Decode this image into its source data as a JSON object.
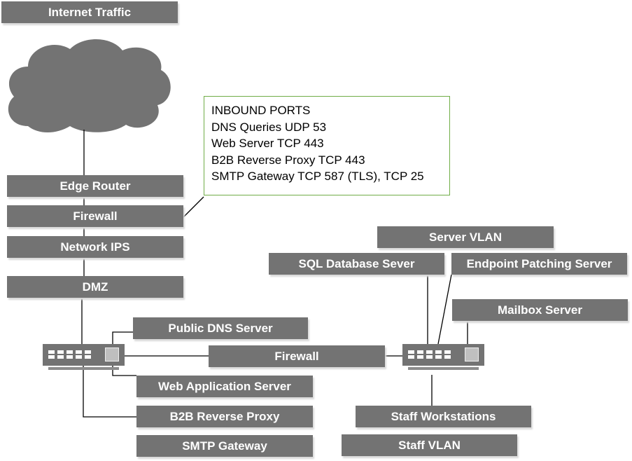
{
  "title": "Internet Traffic",
  "cloud_icon": "cloud-icon",
  "left_chain": [
    "Edge Router",
    "Firewall",
    "Network IPS",
    "DMZ"
  ],
  "callout": {
    "border_color": "#70ad47",
    "lines": [
      "INBOUND PORTS",
      "DNS Queries UDP 53",
      "Web Server TCP 443",
      "B2B Reverse Proxy TCP 443",
      "SMTP Gateway TCP 587 (TLS), TCP 25"
    ]
  },
  "dmz_servers": [
    "Public DNS Server",
    "Web Application Server",
    "B2B Reverse Proxy",
    "SMTP Gateway"
  ],
  "core_firewall": "Firewall",
  "server_vlan": {
    "label": "Server VLAN",
    "servers": [
      "SQL Database Sever",
      "Endpoint Patching Server",
      "Mailbox Server"
    ]
  },
  "staff": {
    "workstations": "Staff Workstations",
    "vlan": "Staff VLAN"
  },
  "colors": {
    "box": "#737373",
    "text": "#ffffff"
  }
}
